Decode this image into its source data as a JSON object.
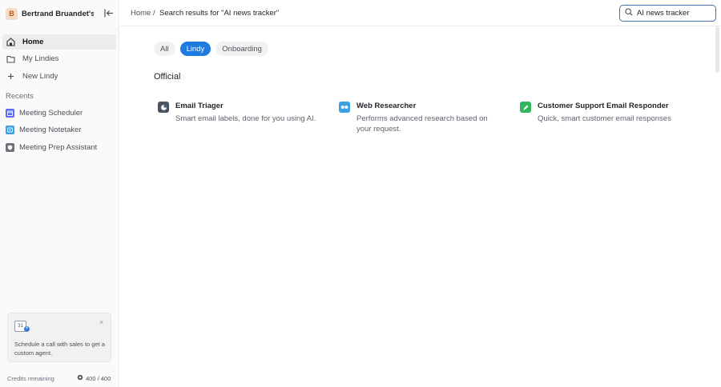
{
  "sidebar": {
    "workspace": {
      "initial": "B",
      "name": "Bertrand Bruandet's..."
    },
    "nav": [
      {
        "label": "Home",
        "icon": "home-icon"
      },
      {
        "label": "My Lindies",
        "icon": "folder-icon"
      },
      {
        "label": "New Lindy",
        "icon": "plus-icon"
      }
    ],
    "recents_title": "Recents",
    "recents": [
      {
        "label": "Meeting Scheduler",
        "icon": "calendar-icon",
        "color": "#5b6cf0"
      },
      {
        "label": "Meeting Notetaker",
        "icon": "notes-icon",
        "color": "#3aa0e8"
      },
      {
        "label": "Meeting Prep Assistant",
        "icon": "shield-icon",
        "color": "#6d737c"
      }
    ],
    "promo": {
      "calendar_number": "31",
      "close": "×",
      "text": "Schedule a call with sales to get a custom agent."
    },
    "credits": {
      "label": "Credits remaining",
      "value": "400 / 400"
    }
  },
  "topbar": {
    "breadcrumb": {
      "home": "Home",
      "separator": "/",
      "current": "Search results for \"AI news tracker\""
    },
    "search": {
      "value": "AI news tracker",
      "icon": "search-icon"
    }
  },
  "main": {
    "tabs": [
      {
        "label": "All",
        "active": false
      },
      {
        "label": "Lindy",
        "active": true
      },
      {
        "label": "Onboarding",
        "active": false
      }
    ],
    "section_title": "Official",
    "cards": [
      {
        "title": "Email Triager",
        "desc": "Smart email labels, done for you using AI.",
        "icon": "email-triager-icon",
        "color": "#4a5563"
      },
      {
        "title": "Web Researcher",
        "desc": "Performs advanced research based on your request.",
        "icon": "web-researcher-icon",
        "color": "#3aa0e8"
      },
      {
        "title": "Customer Support Email Responder",
        "desc": "Quick, smart customer email responses",
        "icon": "customer-support-icon",
        "color": "#2eb85c"
      }
    ]
  },
  "colors": {
    "accent": "#1f7ae0",
    "search_border": "#3c6fb3"
  }
}
